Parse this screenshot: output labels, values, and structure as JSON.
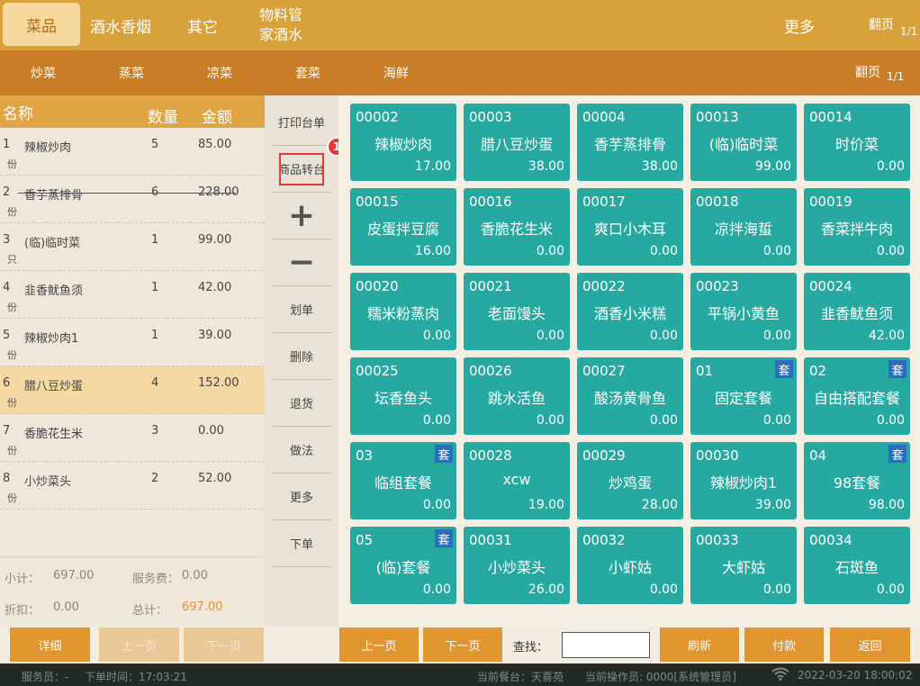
{
  "top_categories": [
    {
      "label": "菜品",
      "active": true
    },
    {
      "label": "酒水香烟",
      "active": false
    },
    {
      "label": "其它",
      "active": false
    },
    {
      "label": "物料管家酒水",
      "line1": "物料管",
      "line2": "家酒水",
      "active": false
    }
  ],
  "top_more": "更多",
  "top_pager": {
    "label": "翻页",
    "value": "1/1"
  },
  "sub_categories": [
    "炒菜",
    "蒸菜",
    "凉菜",
    "套菜",
    "海鲜"
  ],
  "sub_pager": {
    "label": "翻页",
    "value": "1/1"
  },
  "order": {
    "headers": {
      "name": "名称",
      "qty": "数量",
      "amount": "金额"
    },
    "rows": [
      {
        "idx": "1",
        "name": "辣椒炒肉",
        "qty": "5",
        "amount": "85.00",
        "unit": "份",
        "struck": false,
        "selected": false
      },
      {
        "idx": "2",
        "name": "香芋蒸排骨",
        "qty": "6",
        "amount": "228.00",
        "unit": "份",
        "struck": true,
        "selected": false
      },
      {
        "idx": "3",
        "name": "(临)临时菜",
        "qty": "1",
        "amount": "99.00",
        "unit": "只",
        "struck": false,
        "selected": false
      },
      {
        "idx": "4",
        "name": "韭香鱿鱼须",
        "qty": "1",
        "amount": "42.00",
        "unit": "份",
        "struck": false,
        "selected": false
      },
      {
        "idx": "5",
        "name": "辣椒炒肉1",
        "qty": "1",
        "amount": "39.00",
        "unit": "份",
        "struck": false,
        "selected": false
      },
      {
        "idx": "6",
        "name": "腊八豆炒蛋",
        "qty": "4",
        "amount": "152.00",
        "unit": "份",
        "struck": false,
        "selected": true
      },
      {
        "idx": "7",
        "name": "香脆花生米",
        "qty": "3",
        "amount": "0.00",
        "unit": "份",
        "struck": false,
        "selected": false
      },
      {
        "idx": "8",
        "name": "小炒菜头",
        "qty": "2",
        "amount": "52.00",
        "unit": "份",
        "struck": false,
        "selected": false
      }
    ],
    "summary": {
      "subtotal_label": "小计：",
      "subtotal": "697.00",
      "service_label": "服务费：",
      "service": "0.00",
      "discount_label": "折扣：",
      "discount": "0.00",
      "total_label": "总计：",
      "total": "697.00"
    }
  },
  "tools": [
    {
      "label": "打印台单",
      "kind": "text"
    },
    {
      "label": "商品转台",
      "kind": "text",
      "highlighted": true
    },
    {
      "label": "+",
      "kind": "big"
    },
    {
      "label": "−",
      "kind": "big"
    },
    {
      "label": "划单",
      "kind": "text"
    },
    {
      "label": "删除",
      "kind": "text"
    },
    {
      "label": "退货",
      "kind": "text"
    },
    {
      "label": "做法",
      "kind": "text"
    },
    {
      "label": "更多",
      "kind": "text"
    },
    {
      "label": "下单",
      "kind": "text"
    }
  ],
  "badge": "1",
  "dishes": [
    {
      "code": "00002",
      "name": "辣椒炒肉",
      "price": "17.00",
      "set": false
    },
    {
      "code": "00003",
      "name": "腊八豆炒蛋",
      "price": "38.00",
      "set": false
    },
    {
      "code": "00004",
      "name": "香芋蒸排骨",
      "price": "38.00",
      "set": false
    },
    {
      "code": "00013",
      "name": "(临)临时菜",
      "price": "99.00",
      "set": false
    },
    {
      "code": "00014",
      "name": "时价菜",
      "price": "0.00",
      "set": false
    },
    {
      "code": "00015",
      "name": "皮蛋拌豆腐",
      "price": "16.00",
      "set": false
    },
    {
      "code": "00016",
      "name": "香脆花生米",
      "price": "0.00",
      "set": false
    },
    {
      "code": "00017",
      "name": "爽口小木耳",
      "price": "0.00",
      "set": false
    },
    {
      "code": "00018",
      "name": "凉拌海蜇",
      "price": "0.00",
      "set": false
    },
    {
      "code": "00019",
      "name": "香菜拌牛肉",
      "price": "0.00",
      "set": false
    },
    {
      "code": "00020",
      "name": "糯米粉蒸肉",
      "price": "0.00",
      "set": false
    },
    {
      "code": "00021",
      "name": "老面馒头",
      "price": "0.00",
      "set": false
    },
    {
      "code": "00022",
      "name": "酒香小米糕",
      "price": "0.00",
      "set": false
    },
    {
      "code": "00023",
      "name": "平锅小黄鱼",
      "price": "0.00",
      "set": false
    },
    {
      "code": "00024",
      "name": "韭香鱿鱼须",
      "price": "42.00",
      "set": false
    },
    {
      "code": "00025",
      "name": "坛香鱼头",
      "price": "0.00",
      "set": false
    },
    {
      "code": "00026",
      "name": "跳水活鱼",
      "price": "0.00",
      "set": false
    },
    {
      "code": "00027",
      "name": "酸汤黄骨鱼",
      "price": "0.00",
      "set": false
    },
    {
      "code": "01",
      "name": "固定套餐",
      "price": "0.00",
      "set": true
    },
    {
      "code": "02",
      "name": "自由搭配套餐",
      "price": "0.00",
      "set": true
    },
    {
      "code": "03",
      "name": "临组套餐",
      "price": "0.00",
      "set": true
    },
    {
      "code": "00028",
      "name": "xcw",
      "price": "19.00",
      "set": false
    },
    {
      "code": "00029",
      "name": "炒鸡蛋",
      "price": "28.00",
      "set": false
    },
    {
      "code": "00030",
      "name": "辣椒炒肉1",
      "price": "39.00",
      "set": false
    },
    {
      "code": "04",
      "name": "98套餐",
      "price": "98.00",
      "set": true
    },
    {
      "code": "05",
      "name": "(临)套餐",
      "price": "0.00",
      "set": true
    },
    {
      "code": "00031",
      "name": "小炒菜头",
      "price": "26.00",
      "set": false
    },
    {
      "code": "00032",
      "name": "小虾姑",
      "price": "0.00",
      "set": false
    },
    {
      "code": "00033",
      "name": "大虾姑",
      "price": "0.00",
      "set": false
    },
    {
      "code": "00034",
      "name": "石斑鱼",
      "price": "0.00",
      "set": false
    }
  ],
  "set_tag": "套",
  "bottom": {
    "detail": "详细",
    "left_prev": "上一页",
    "left_next": "下一页",
    "prev": "上一页",
    "next": "下一页",
    "search_label": "查找：",
    "search_value": "",
    "refresh": "刷新",
    "pay": "付款",
    "back": "返回"
  },
  "status": {
    "waiter": "服务员：-",
    "order_time": "下单时间：17:03:21",
    "table": "当前餐台：天喜苑",
    "operator": "当前操作员:  0000[系统管理员]",
    "datetime": "2022-03-20 18:00:02"
  },
  "colors": {
    "top_bar": "#d9a13a",
    "sub_bar": "#c97d26",
    "tile": "#26a9a0",
    "set_tag": "#2a6dbf",
    "accent": "#e0952f",
    "highlight": "#e53935"
  }
}
